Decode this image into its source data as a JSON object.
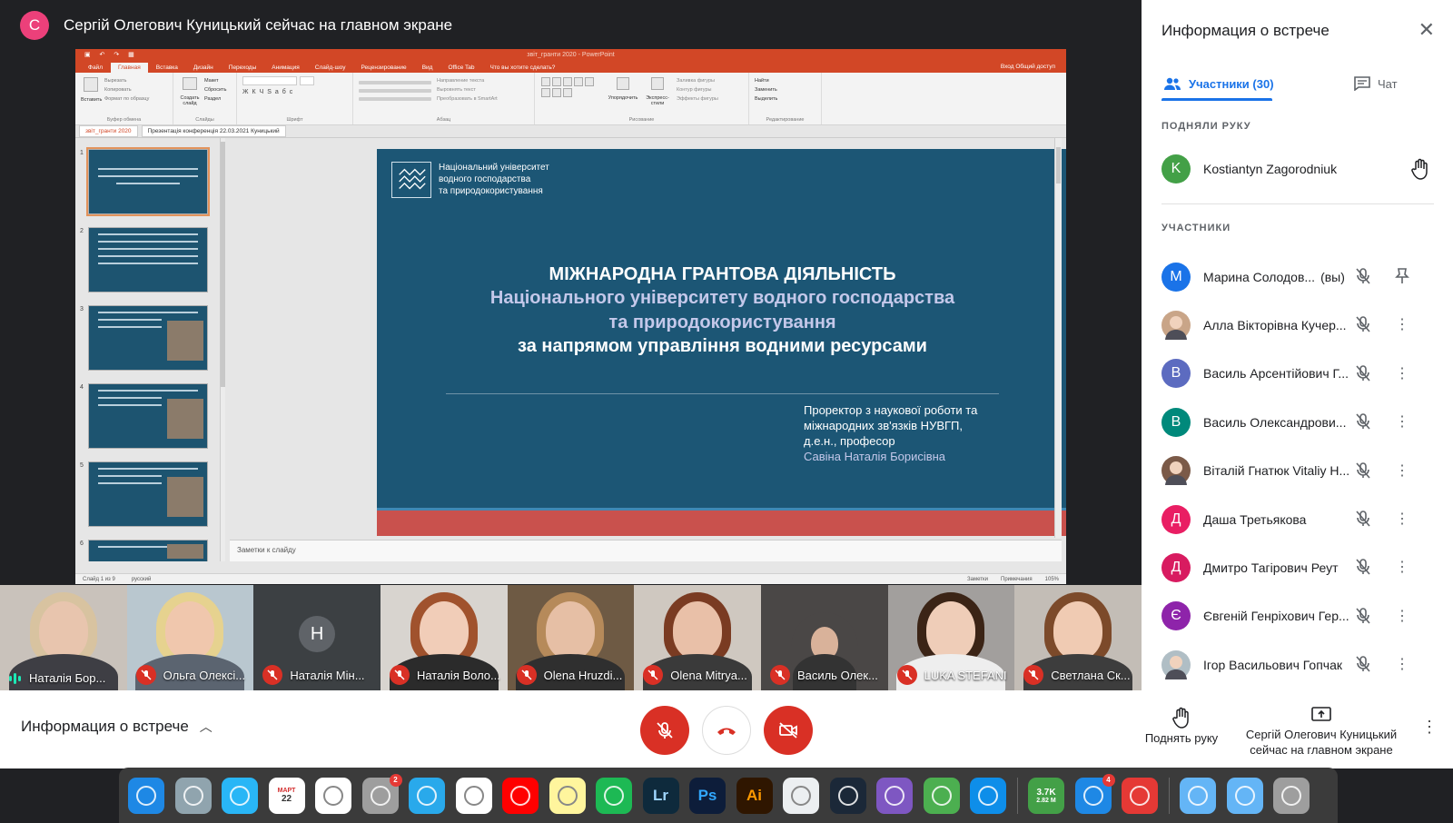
{
  "presenter_banner": {
    "initial": "С",
    "text": "Сергій Олегович Куницький сейчас на главном экране",
    "avatar_color": "#ec407a"
  },
  "powerpoint": {
    "window_title": "звіт_гранти 2020 - PowerPoint",
    "menu_tabs": [
      "Файл",
      "Главная",
      "Вставка",
      "Дизайн",
      "Переходы",
      "Анимация",
      "Слайд-шоу",
      "Рецензирование",
      "Вид",
      "Office Tab",
      "Что вы хотите сделать?"
    ],
    "active_tab": "Главная",
    "share": "Вход   Общий доступ",
    "ribbon_groups": [
      "Буфер обмена",
      "Слайды",
      "Шрифт",
      "Абзац",
      "Рисование",
      "Редактирование"
    ],
    "ribbon_items": {
      "paste": "Вставить",
      "cut": "Вырезать",
      "copy": "Копировать",
      "format": "Формат по образцу",
      "new_slide": "Создать слайд",
      "layout": "Макет",
      "reset": "Сбросить",
      "section": "Раздел",
      "text_dir": "Направление текста",
      "align": "Выровнять текст",
      "smartart": "Преобразовать в SmartArt",
      "arrange": "Упорядочить",
      "quick": "Экспресс-стили",
      "fill": "Заливка фигуры",
      "outline": "Контур фигуры",
      "effects": "Эффекты фигуры",
      "find": "Найти",
      "replace": "Заменить",
      "select": "Выделить"
    },
    "doc_tabs": [
      "звіт_гранти 2020",
      "Презентація конференція 22.03.2021 Куницький"
    ],
    "thumb_numbers": [
      "1",
      "2",
      "3",
      "4",
      "5",
      "6"
    ],
    "notes_placeholder": "Заметки к слайду",
    "status_left": [
      "Слайд 1 из 9",
      "русский"
    ],
    "status_right": [
      "Заметки",
      "Примечания",
      "105%"
    ]
  },
  "slide": {
    "org_lines": [
      "Національний університет",
      "водного господарства",
      "та природокористування"
    ],
    "title_1": "МІЖНАРОДНА ГРАНТОВА ДІЯЛЬНІСТЬ",
    "title_2": "Національного університету водного господарства",
    "title_3": "та природокористування",
    "title_4": "за напрямом управління водними ресурсами",
    "author_lines": [
      "Проректор з наукової роботи та",
      "міжнародних зв'язків НУВГП,",
      "д.е.н., професор"
    ],
    "author_name": "Савіна Наталія Борисівна",
    "colors": {
      "bg": "#1c5675",
      "accent": "#c9514d",
      "subtitle": "#c4c8ea"
    }
  },
  "tiles": [
    {
      "label": "Наталія Бор...",
      "state": "speaking"
    },
    {
      "label": "Ольга Олексі...",
      "state": "muted"
    },
    {
      "label": "Наталія Мін...",
      "state": "muted",
      "initial": "Н"
    },
    {
      "label": "Наталія Воло...",
      "state": "muted"
    },
    {
      "label": "Olena Hruzdi...",
      "state": "muted"
    },
    {
      "label": "Olena Mitrya...",
      "state": "muted"
    },
    {
      "label": "Василь Олек...",
      "state": "muted"
    },
    {
      "label": "LUKA STEFANI",
      "state": "muted"
    },
    {
      "label": "Светлана Ск...",
      "state": "muted"
    }
  ],
  "bottom_bar": {
    "meeting_info": "Информация о встрече",
    "raise_hand": "Поднять руку",
    "presenting": [
      "Сергій Олегович Куницький",
      "сейчас на главном экране"
    ]
  },
  "side_panel": {
    "title": "Информация о встрече",
    "tab_people": "Участники (30)",
    "tab_chat": "Чат",
    "raised_section": "ПОДНЯЛИ РУКУ",
    "raised": {
      "initial": "K",
      "name": "Kostiantyn Zagorodniuk",
      "color": "#43a047"
    },
    "participants_section": "УЧАСТНИКИ",
    "participants": [
      {
        "initial": "М",
        "name": "Марина Солодов...",
        "suffix": "(вы)",
        "color": "#1a73e8",
        "action": "pin-icon"
      },
      {
        "initial": "",
        "name": "Алла Вікторівна Кучер...",
        "color": "#c9a588",
        "photo": true,
        "action": "more-icon"
      },
      {
        "initial": "В",
        "name": "Василь Арсентійович Г...",
        "color": "#5c6bc0",
        "action": "more-icon"
      },
      {
        "initial": "В",
        "name": "Василь Олександрови...",
        "color": "#00897b",
        "action": "more-icon"
      },
      {
        "initial": "",
        "name": "Віталій Гнатюк Vitaliy H...",
        "color": "#7b5a48",
        "photo": true,
        "action": "more-icon"
      },
      {
        "initial": "Д",
        "name": "Даша Третьякова",
        "color": "#e91e63",
        "action": "more-icon"
      },
      {
        "initial": "Д",
        "name": "Дмитро Тагірович Реут",
        "color": "#d81b60",
        "action": "more-icon"
      },
      {
        "initial": "Є",
        "name": "Євгеній Генріхович Гер...",
        "color": "#8e24aa",
        "action": "more-icon"
      },
      {
        "initial": "",
        "name": "Ігор Васильович Гопчак",
        "color": "#b0bec5",
        "photo": true,
        "action": "more-icon"
      }
    ]
  },
  "dock": {
    "apps": [
      {
        "name": "finder-icon",
        "color": "#1e88e5"
      },
      {
        "name": "launchpad-icon",
        "color": "#90a4ae"
      },
      {
        "name": "safari-icon",
        "color": "#29b6f6"
      },
      {
        "name": "calendar-icon",
        "color": "#ffffff",
        "text": "22",
        "sub": "МАРТ"
      },
      {
        "name": "photos-icon",
        "color": "#ffffff"
      },
      {
        "name": "system-preferences-icon",
        "color": "#9e9e9e",
        "badge": "2"
      },
      {
        "name": "telegram-icon",
        "color": "#29a9eb"
      },
      {
        "name": "chrome-icon",
        "color": "#ffffff"
      },
      {
        "name": "youtube-icon",
        "color": "#ff0000"
      },
      {
        "name": "notes-icon",
        "color": "#fff59d"
      },
      {
        "name": "spotify-icon",
        "color": "#1db954"
      },
      {
        "name": "lightroom-icon",
        "color": "#0e2a3c",
        "text": "Lr",
        "tc": "#9fd6ff"
      },
      {
        "name": "photoshop-icon",
        "color": "#0d1d3a",
        "text": "Ps",
        "tc": "#31a8ff"
      },
      {
        "name": "illustrator-icon",
        "color": "#2f1600",
        "text": "Ai",
        "tc": "#ff9a00"
      },
      {
        "name": "settings-gear-icon",
        "color": "#eceff1"
      },
      {
        "name": "steam-icon",
        "color": "#1b2838"
      },
      {
        "name": "imovie-star-icon",
        "color": "#7e57c2"
      },
      {
        "name": "facetime-icon",
        "color": "#4caf50"
      },
      {
        "name": "teamviewer-icon",
        "color": "#0e8ee9"
      },
      {
        "name": "activity-monitor-icon",
        "color": "#43a047",
        "text": "3.7K",
        "sub": "2.82 M"
      },
      {
        "name": "app-store-icon",
        "color": "#1e88e5",
        "badge": "4"
      },
      {
        "name": "arrow-app-icon",
        "color": "#e53935"
      },
      {
        "name": "downloads-folder-icon",
        "color": "#64b5f6"
      },
      {
        "name": "folder-icon",
        "color": "#64b5f6"
      },
      {
        "name": "trash-icon",
        "color": "#9e9e9e"
      }
    ]
  }
}
